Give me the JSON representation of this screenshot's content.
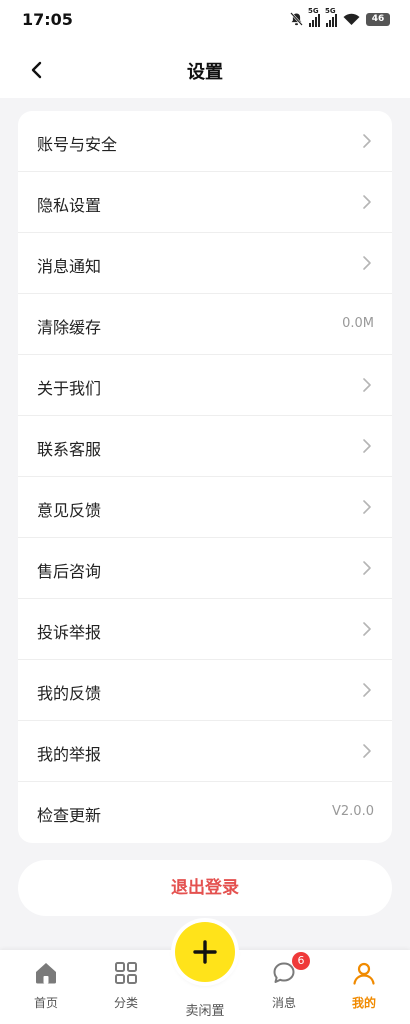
{
  "status_bar": {
    "time": "17:05",
    "battery": "46",
    "network": [
      "5G",
      "5G"
    ]
  },
  "header": {
    "title": "设置"
  },
  "settings": {
    "items": [
      {
        "label": "账号与安全"
      },
      {
        "label": "隐私设置"
      },
      {
        "label": "消息通知"
      },
      {
        "label": "清除缓存",
        "value": "0.0M"
      },
      {
        "label": "关于我们"
      },
      {
        "label": "联系客服"
      },
      {
        "label": "意见反馈"
      },
      {
        "label": "售后咨询"
      },
      {
        "label": "投诉举报"
      },
      {
        "label": "我的反馈"
      },
      {
        "label": "我的举报"
      },
      {
        "label": "检查更新",
        "value": "V2.0.0"
      }
    ]
  },
  "logout": {
    "label": "退出登录"
  },
  "tabbar": {
    "home": {
      "label": "首页",
      "icon": "home-icon"
    },
    "category": {
      "label": "分类",
      "icon": "grid-icon"
    },
    "sell": {
      "label": "卖闲置",
      "icon": "plus-icon"
    },
    "messages": {
      "label": "消息",
      "icon": "chat-icon",
      "badge": "6"
    },
    "mine": {
      "label": "我的",
      "icon": "person-icon",
      "active": true
    }
  },
  "colors": {
    "accent": "#f08a00",
    "danger": "#e4514f",
    "fab": "#ffe31a",
    "badge": "#ef3a3a"
  }
}
